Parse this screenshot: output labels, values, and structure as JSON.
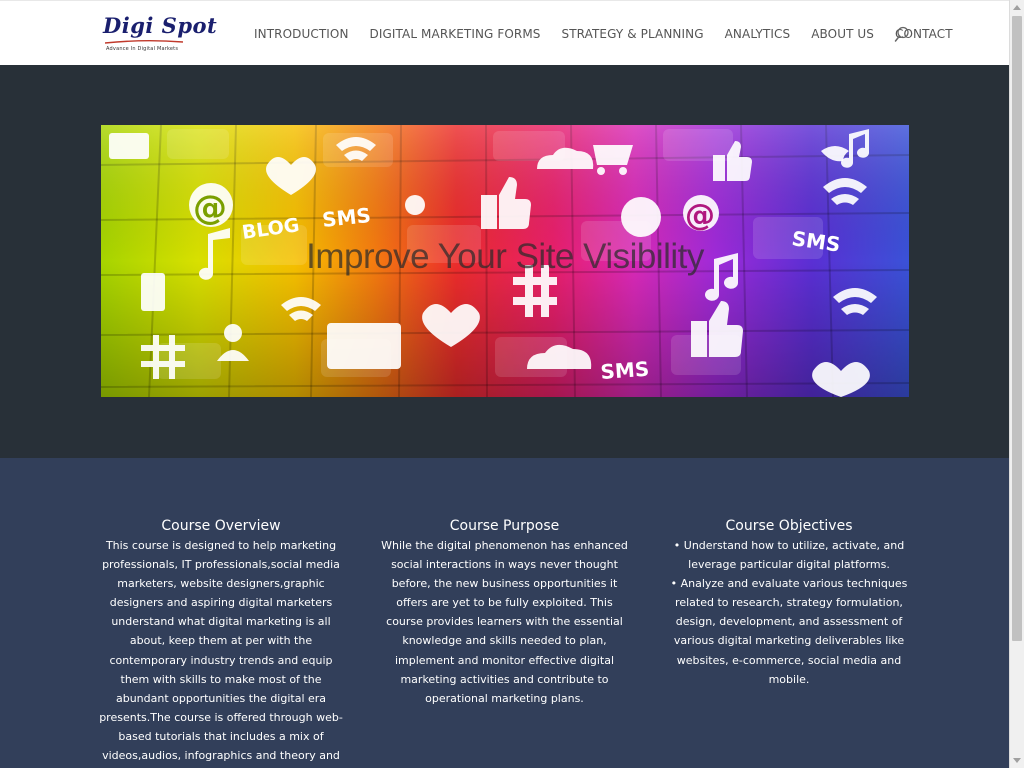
{
  "brand": {
    "name": "Digi Spot",
    "tagline": "Advance In Digital Markets"
  },
  "nav": {
    "items": [
      {
        "label": "INTRODUCTION"
      },
      {
        "label": "DIGITAL MARKETING FORMS"
      },
      {
        "label": "STRATEGY & PLANNING"
      },
      {
        "label": "ANALYTICS"
      },
      {
        "label": "ABOUT US"
      },
      {
        "label": "CONTACT"
      }
    ],
    "search_icon": "search-icon"
  },
  "hero": {
    "title": "Improve Your Site Visibility",
    "banner_labels": {
      "blog": "BLOG",
      "sms1": "SMS",
      "sms2": "SMS",
      "sms3": "SMS",
      "at1": "@",
      "at2": "@",
      "hash1": "#",
      "hash2": "#"
    }
  },
  "courses": {
    "overview": {
      "title": "Course Overview",
      "body": "This course is designed to help marketing\nprofessionals, IT professionals,social media\nmarketers, website designers,graphic\ndesigners and aspiring digital marketers\nunderstand what digital marketing is all\nabout, keep them at per with the\ncontemporary industry trends and equip\nthem with skills to make most of the\nabundant opportunities the digital era\npresents.The course is offered through web-\nbased tutorials that includes a mix of\nvideos,audios, infographics and theory and"
    },
    "purpose": {
      "title": "Course Purpose",
      "body": "While the digital phenomenon has enhanced\nsocial interactions in ways never thought\nbefore, the new business opportunities it\noffers are yet to be fully exploited. This\ncourse provides learners with the essential\nknowledge and skills needed to plan,\nimplement and monitor effective digital\nmarketing activities and contribute to\noperational marketing plans."
    },
    "objectives": {
      "title": "Course Objectives",
      "body": "• Understand how to utilize, activate, and\nleverage particular digital platforms.\n• Analyze and evaluate various techniques\nrelated to research, strategy formulation,\ndesign, development, and assessment of\nvarious digital marketing deliverables like\nwebsites, e-commerce, social media and\nmobile."
    }
  },
  "colors": {
    "header_bg": "#ffffff",
    "hero_bg": "#283038",
    "courses_bg": "#323f5a",
    "brand_navy": "#1a1f6e",
    "nav_text": "#555555"
  }
}
